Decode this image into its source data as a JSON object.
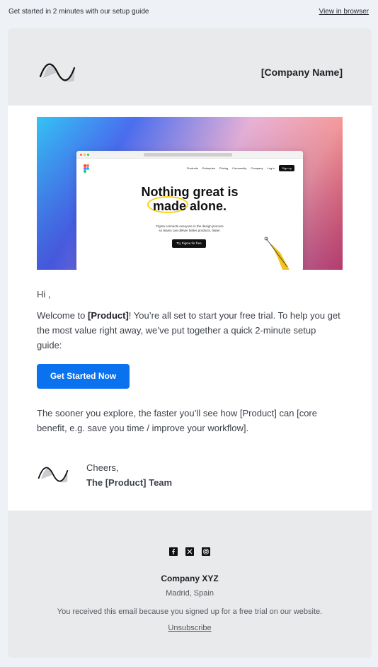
{
  "preheader": {
    "text": "Get started in 2 minutes with our setup guide",
    "view_in_browser": "View in browser"
  },
  "header": {
    "logo_icon": "wave-logo-icon",
    "company_name": "[Company Name]"
  },
  "hero": {
    "headline_line1": "Nothing great is",
    "headline_line2": "made alone.",
    "subtext_line1": "Figma connects everyone in the design process",
    "subtext_line2": "so teams can deliver better products, faster.",
    "cta": "Try Figma for free",
    "nav": [
      "Products",
      "Enterprise",
      "Pricing",
      "Community",
      "Company",
      "Log in"
    ],
    "signup": "Sign up"
  },
  "body": {
    "greeting": "Hi ,",
    "welcome_prefix": "Welcome to ",
    "welcome_product": "[Product]",
    "welcome_rest": "! You’re all set to start your free trial. To help you get the most value right away, we’ve put together a quick 2-minute setup guide:",
    "cta_label": "Get Started Now",
    "sooner": "The sooner you explore, the faster you’ll see how [Product] can [core benefit, e.g. save you time / improve your workflow]."
  },
  "signature": {
    "logo_icon": "wave-logo-icon",
    "cheers": "Cheers,",
    "team": "The [Product] Team"
  },
  "footer": {
    "socials": [
      "facebook-icon",
      "x-icon",
      "instagram-icon"
    ],
    "company": "Company XYZ",
    "address": "Madrid, Spain",
    "reason": "You received this email because you signed up for a free trial on our website.",
    "unsubscribe": "Unsubscribe"
  },
  "colors": {
    "cta": "#0a72ef",
    "header_bg": "#e9eaeb",
    "page_bg": "#eef1f5"
  }
}
